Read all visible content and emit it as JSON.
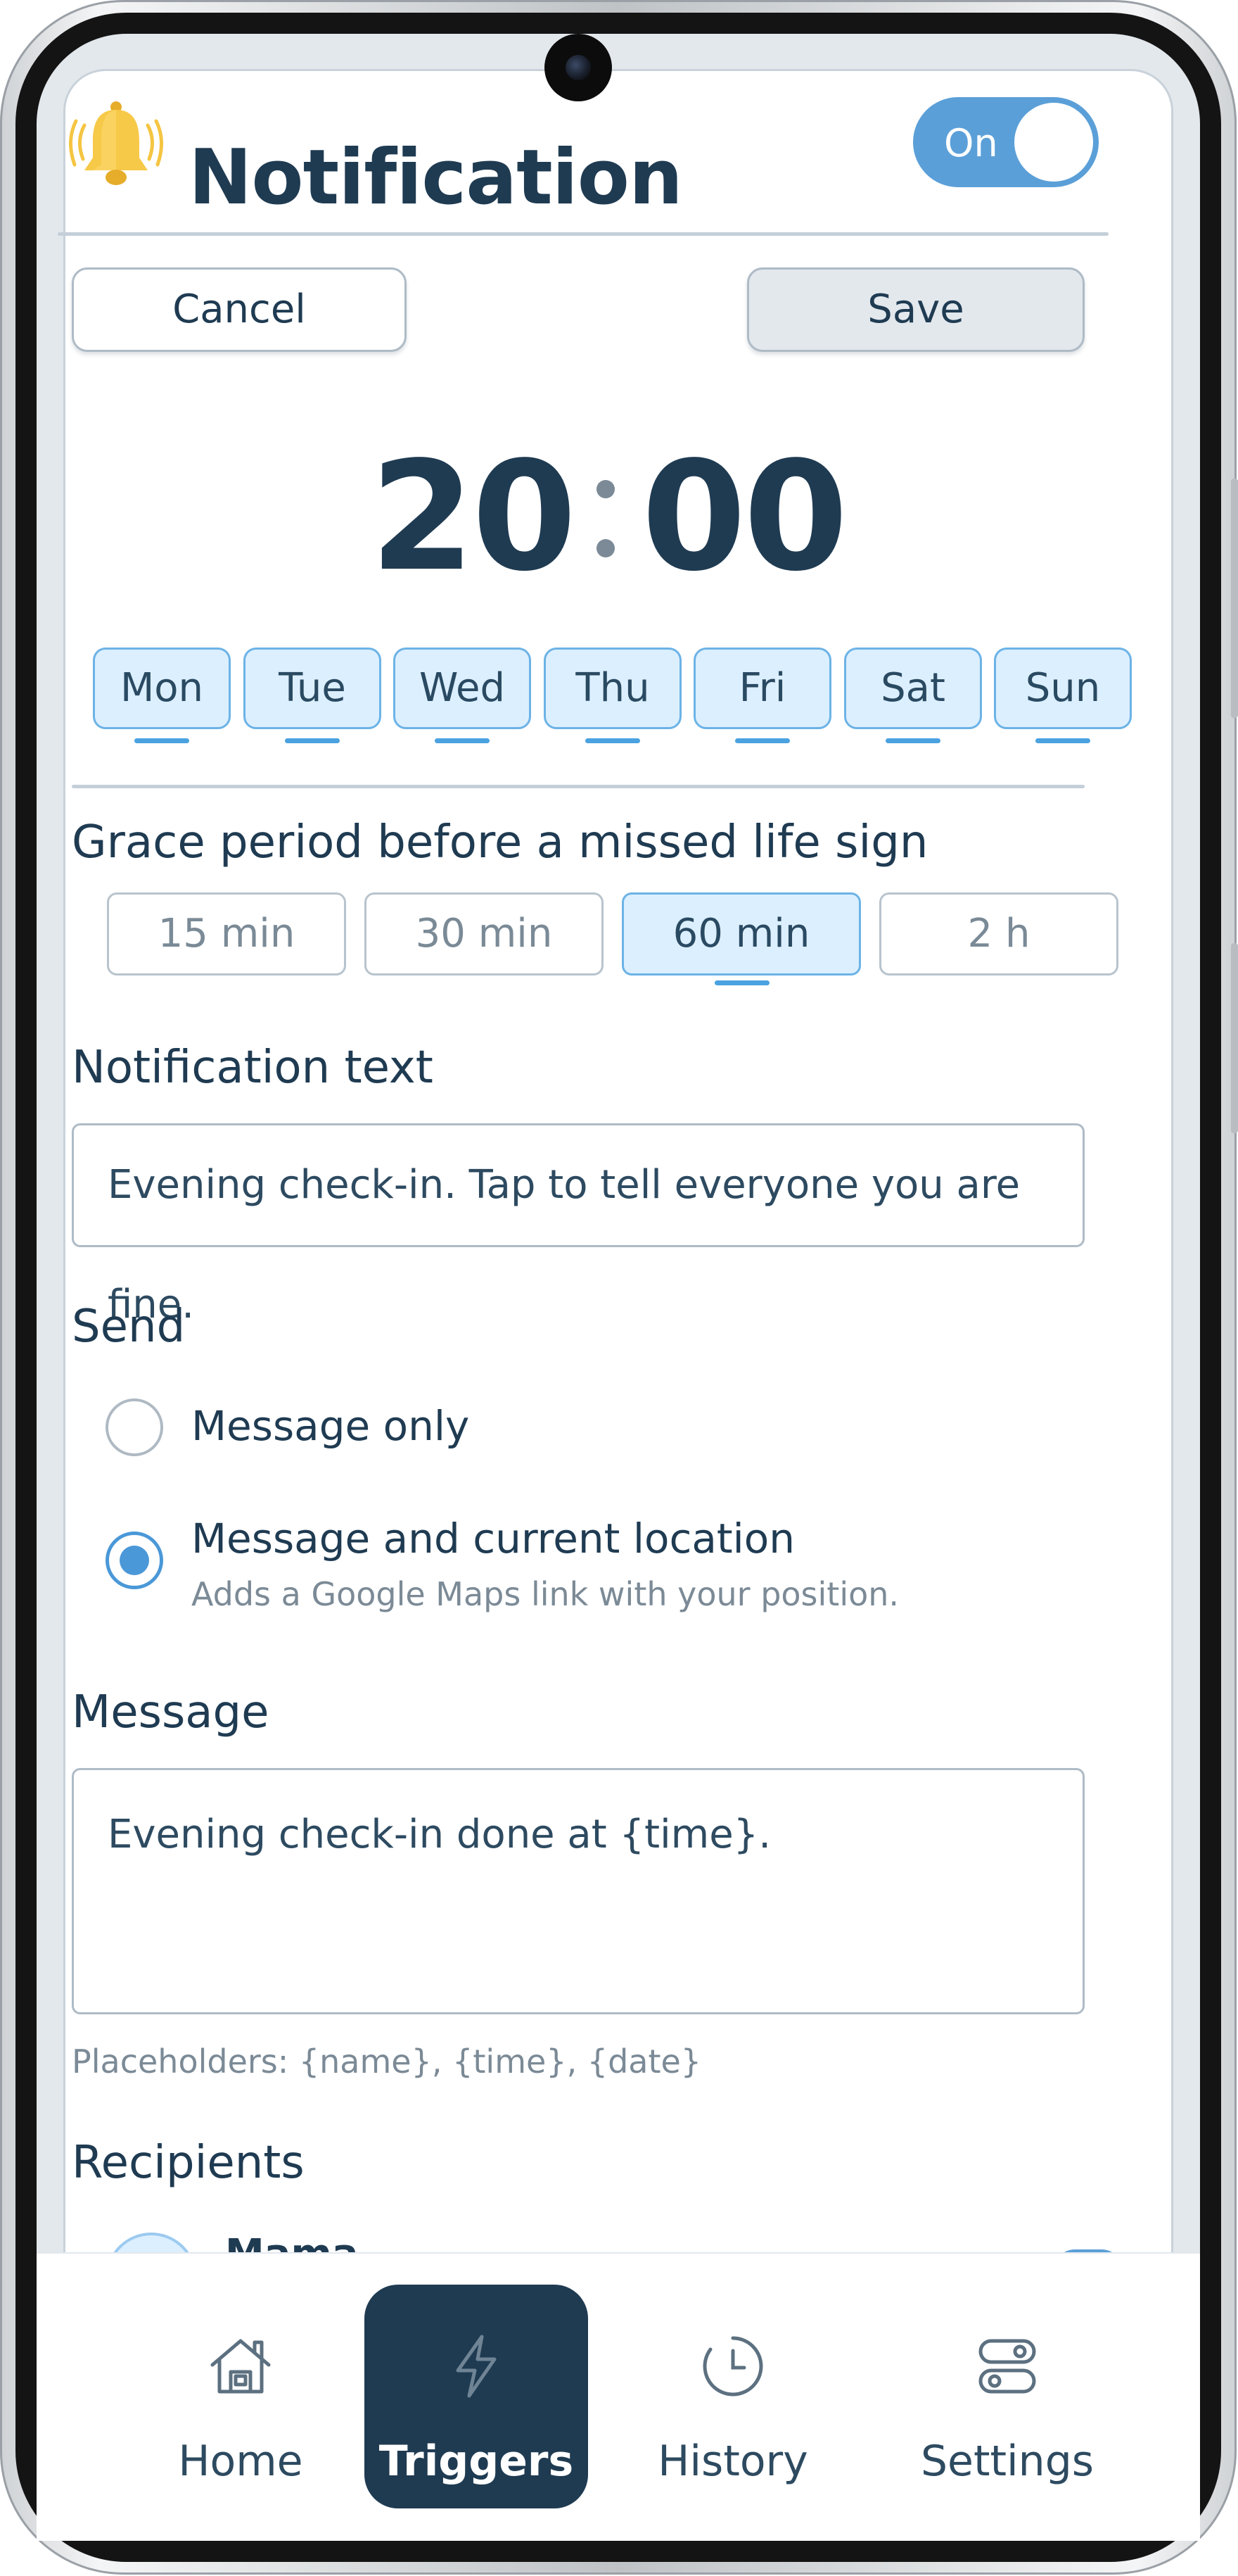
{
  "header": {
    "title": "Notification",
    "toggle_label": "On",
    "toggle_on": true
  },
  "actions": {
    "cancel_label": "Cancel",
    "save_label": "Save"
  },
  "time": {
    "hours": "20",
    "separator": ":",
    "minutes": "00"
  },
  "days": [
    {
      "label": "Mon",
      "selected": true
    },
    {
      "label": "Tue",
      "selected": true
    },
    {
      "label": "Wed",
      "selected": true
    },
    {
      "label": "Thu",
      "selected": true
    },
    {
      "label": "Fri",
      "selected": true
    },
    {
      "label": "Sat",
      "selected": true
    },
    {
      "label": "Sun",
      "selected": true
    }
  ],
  "grace": {
    "label": "Grace period before a missed life sign",
    "options": [
      "15 min",
      "30 min",
      "60 min",
      "2 h"
    ],
    "selected": "60 min"
  },
  "notification_text": {
    "label": "Notification text",
    "value": "Evening check-in. Tap to tell everyone you are fine."
  },
  "send": {
    "label": "Send",
    "options": [
      {
        "label": "Message only",
        "description": "",
        "checked": false
      },
      {
        "label": "Message and current location",
        "description": "Adds a Google Maps link with your position.",
        "checked": true
      }
    ]
  },
  "message": {
    "label": "Message",
    "value": "Evening check-in done at {time}.",
    "hint": "Placeholders: {name}, {time}, {date}"
  },
  "recipients": {
    "label": "Recipients",
    "items": [
      {
        "name": "Mama",
        "enabled": true
      }
    ]
  },
  "nav": {
    "items": [
      {
        "label": "Home",
        "icon": "home-icon",
        "active": false
      },
      {
        "label": "Triggers",
        "icon": "lightning-icon",
        "active": true
      },
      {
        "label": "History",
        "icon": "clock-icon",
        "active": false
      },
      {
        "label": "Settings",
        "icon": "settings-toggles-icon",
        "active": false
      }
    ]
  },
  "colors": {
    "accent": "#5b9fd8",
    "primary_text": "#1f3b52",
    "chip_selected_bg": "#dcefff",
    "nav_active_bg": "#1f3b52",
    "bell": "#f5c542"
  }
}
